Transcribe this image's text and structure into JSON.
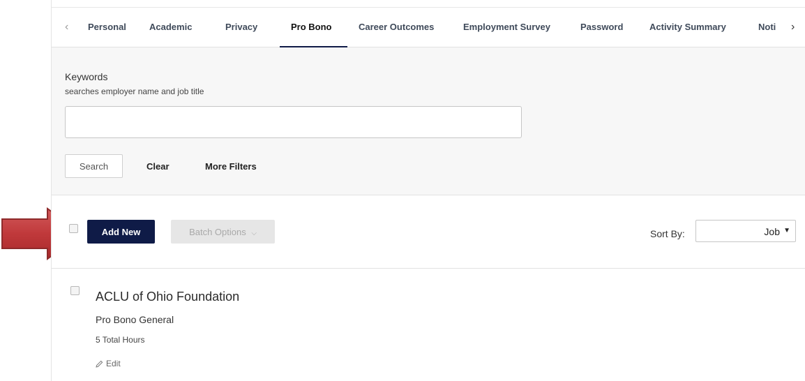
{
  "tabs": {
    "prev_icon": "chevron-left-icon",
    "next_icon": "chevron-right-icon",
    "items": [
      {
        "label": "Personal"
      },
      {
        "label": "Academic"
      },
      {
        "label": "Privacy"
      },
      {
        "label": "Pro Bono"
      },
      {
        "label": "Career Outcomes"
      },
      {
        "label": "Employment Survey"
      },
      {
        "label": "Password"
      },
      {
        "label": "Activity Summary"
      },
      {
        "label": "Noti"
      }
    ],
    "active": "Pro Bono"
  },
  "filters": {
    "keywords_label": "Keywords",
    "keywords_hint": "searches employer name and job title",
    "keywords_value": "",
    "search_label": "Search",
    "clear_label": "Clear",
    "more_filters_label": "More Filters"
  },
  "toolbar": {
    "add_new_label": "Add New",
    "batch_options_label": "Batch Options",
    "sort_by_label": "Sort By:",
    "sort_value": "Job"
  },
  "results": [
    {
      "title": "ACLU of Ohio Foundation",
      "type": "Pro Bono General",
      "hours": "5 Total Hours",
      "edit_label": "Edit"
    }
  ],
  "colors": {
    "primary": "#0f1b47",
    "annotation_arrow": "#c0393b"
  }
}
